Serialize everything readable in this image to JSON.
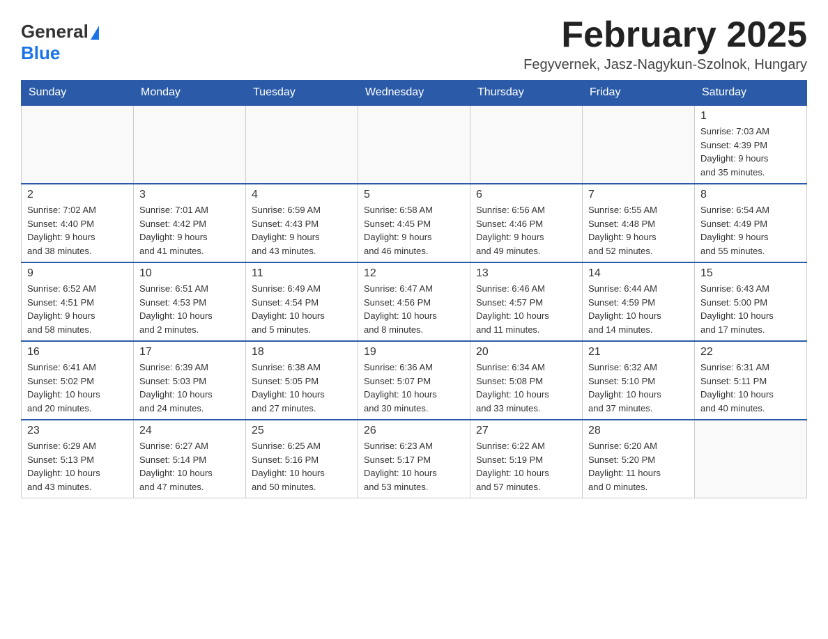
{
  "header": {
    "logo_general": "General",
    "logo_blue": "Blue",
    "title": "February 2025",
    "subtitle": "Fegyvernek, Jasz-Nagykun-Szolnok, Hungary"
  },
  "days_of_week": [
    "Sunday",
    "Monday",
    "Tuesday",
    "Wednesday",
    "Thursday",
    "Friday",
    "Saturday"
  ],
  "weeks": [
    {
      "days": [
        {
          "number": "",
          "info": "",
          "empty": true
        },
        {
          "number": "",
          "info": "",
          "empty": true
        },
        {
          "number": "",
          "info": "",
          "empty": true
        },
        {
          "number": "",
          "info": "",
          "empty": true
        },
        {
          "number": "",
          "info": "",
          "empty": true
        },
        {
          "number": "",
          "info": "",
          "empty": true
        },
        {
          "number": "1",
          "info": "Sunrise: 7:03 AM\nSunset: 4:39 PM\nDaylight: 9 hours\nand 35 minutes.",
          "empty": false
        }
      ]
    },
    {
      "days": [
        {
          "number": "2",
          "info": "Sunrise: 7:02 AM\nSunset: 4:40 PM\nDaylight: 9 hours\nand 38 minutes.",
          "empty": false
        },
        {
          "number": "3",
          "info": "Sunrise: 7:01 AM\nSunset: 4:42 PM\nDaylight: 9 hours\nand 41 minutes.",
          "empty": false
        },
        {
          "number": "4",
          "info": "Sunrise: 6:59 AM\nSunset: 4:43 PM\nDaylight: 9 hours\nand 43 minutes.",
          "empty": false
        },
        {
          "number": "5",
          "info": "Sunrise: 6:58 AM\nSunset: 4:45 PM\nDaylight: 9 hours\nand 46 minutes.",
          "empty": false
        },
        {
          "number": "6",
          "info": "Sunrise: 6:56 AM\nSunset: 4:46 PM\nDaylight: 9 hours\nand 49 minutes.",
          "empty": false
        },
        {
          "number": "7",
          "info": "Sunrise: 6:55 AM\nSunset: 4:48 PM\nDaylight: 9 hours\nand 52 minutes.",
          "empty": false
        },
        {
          "number": "8",
          "info": "Sunrise: 6:54 AM\nSunset: 4:49 PM\nDaylight: 9 hours\nand 55 minutes.",
          "empty": false
        }
      ]
    },
    {
      "days": [
        {
          "number": "9",
          "info": "Sunrise: 6:52 AM\nSunset: 4:51 PM\nDaylight: 9 hours\nand 58 minutes.",
          "empty": false
        },
        {
          "number": "10",
          "info": "Sunrise: 6:51 AM\nSunset: 4:53 PM\nDaylight: 10 hours\nand 2 minutes.",
          "empty": false
        },
        {
          "number": "11",
          "info": "Sunrise: 6:49 AM\nSunset: 4:54 PM\nDaylight: 10 hours\nand 5 minutes.",
          "empty": false
        },
        {
          "number": "12",
          "info": "Sunrise: 6:47 AM\nSunset: 4:56 PM\nDaylight: 10 hours\nand 8 minutes.",
          "empty": false
        },
        {
          "number": "13",
          "info": "Sunrise: 6:46 AM\nSunset: 4:57 PM\nDaylight: 10 hours\nand 11 minutes.",
          "empty": false
        },
        {
          "number": "14",
          "info": "Sunrise: 6:44 AM\nSunset: 4:59 PM\nDaylight: 10 hours\nand 14 minutes.",
          "empty": false
        },
        {
          "number": "15",
          "info": "Sunrise: 6:43 AM\nSunset: 5:00 PM\nDaylight: 10 hours\nand 17 minutes.",
          "empty": false
        }
      ]
    },
    {
      "days": [
        {
          "number": "16",
          "info": "Sunrise: 6:41 AM\nSunset: 5:02 PM\nDaylight: 10 hours\nand 20 minutes.",
          "empty": false
        },
        {
          "number": "17",
          "info": "Sunrise: 6:39 AM\nSunset: 5:03 PM\nDaylight: 10 hours\nand 24 minutes.",
          "empty": false
        },
        {
          "number": "18",
          "info": "Sunrise: 6:38 AM\nSunset: 5:05 PM\nDaylight: 10 hours\nand 27 minutes.",
          "empty": false
        },
        {
          "number": "19",
          "info": "Sunrise: 6:36 AM\nSunset: 5:07 PM\nDaylight: 10 hours\nand 30 minutes.",
          "empty": false
        },
        {
          "number": "20",
          "info": "Sunrise: 6:34 AM\nSunset: 5:08 PM\nDaylight: 10 hours\nand 33 minutes.",
          "empty": false
        },
        {
          "number": "21",
          "info": "Sunrise: 6:32 AM\nSunset: 5:10 PM\nDaylight: 10 hours\nand 37 minutes.",
          "empty": false
        },
        {
          "number": "22",
          "info": "Sunrise: 6:31 AM\nSunset: 5:11 PM\nDaylight: 10 hours\nand 40 minutes.",
          "empty": false
        }
      ]
    },
    {
      "days": [
        {
          "number": "23",
          "info": "Sunrise: 6:29 AM\nSunset: 5:13 PM\nDaylight: 10 hours\nand 43 minutes.",
          "empty": false
        },
        {
          "number": "24",
          "info": "Sunrise: 6:27 AM\nSunset: 5:14 PM\nDaylight: 10 hours\nand 47 minutes.",
          "empty": false
        },
        {
          "number": "25",
          "info": "Sunrise: 6:25 AM\nSunset: 5:16 PM\nDaylight: 10 hours\nand 50 minutes.",
          "empty": false
        },
        {
          "number": "26",
          "info": "Sunrise: 6:23 AM\nSunset: 5:17 PM\nDaylight: 10 hours\nand 53 minutes.",
          "empty": false
        },
        {
          "number": "27",
          "info": "Sunrise: 6:22 AM\nSunset: 5:19 PM\nDaylight: 10 hours\nand 57 minutes.",
          "empty": false
        },
        {
          "number": "28",
          "info": "Sunrise: 6:20 AM\nSunset: 5:20 PM\nDaylight: 11 hours\nand 0 minutes.",
          "empty": false
        },
        {
          "number": "",
          "info": "",
          "empty": true
        }
      ]
    }
  ]
}
